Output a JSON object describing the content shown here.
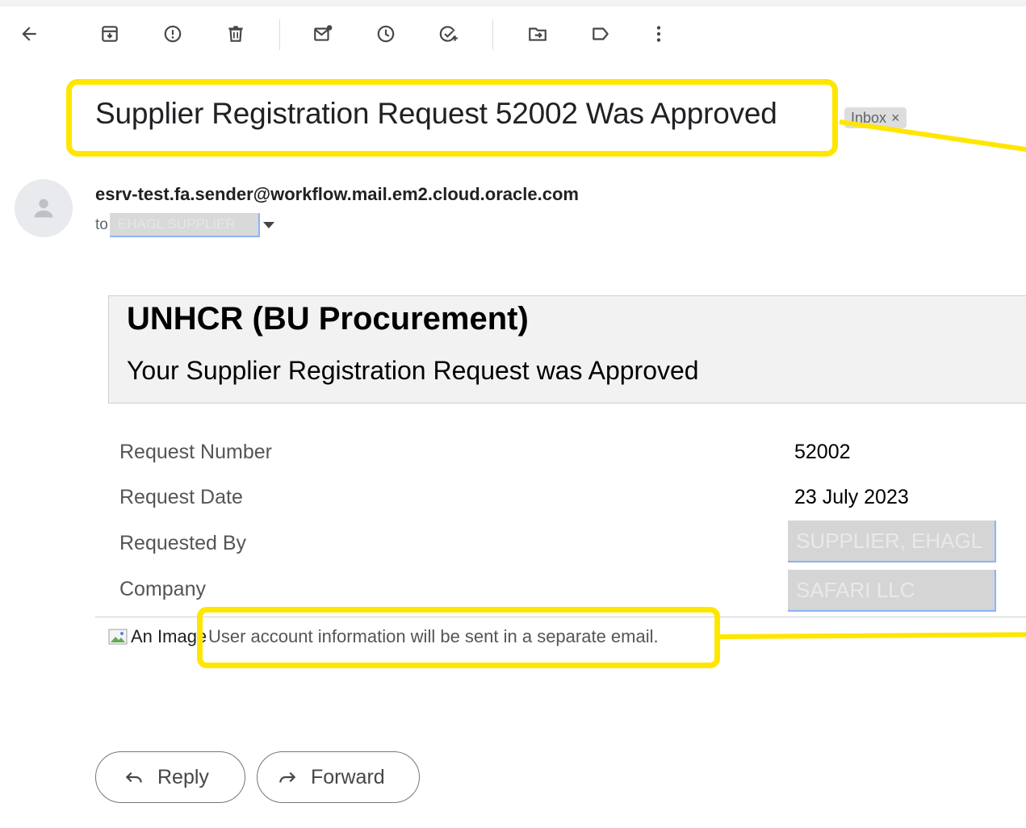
{
  "toolbar": {
    "icons": [
      "back-arrow-icon",
      "archive-icon",
      "report-spam-icon",
      "delete-icon",
      "mark-unread-icon",
      "snooze-icon",
      "add-to-tasks-icon",
      "move-to-icon",
      "label-icon",
      "more-icon"
    ]
  },
  "message": {
    "subject": "Supplier Registration Request 52002 Was Approved",
    "label_chip": "Inbox",
    "label_chip_close": "×",
    "sender_email": "esrv-test.fa.sender@workflow.mail.em2.cloud.oracle.com",
    "to_prefix": "to",
    "to_recipient": "EHAGL SUPPLIER"
  },
  "email_body": {
    "org_name": "UNHCR (BU Procurement)",
    "headline": "Your Supplier Registration Request was Approved",
    "rows": [
      {
        "label": "Request Number",
        "value": "52002"
      },
      {
        "label": "Request Date",
        "value": "23 July 2023"
      },
      {
        "label": "Requested By",
        "value": "SUPPLIER, EHAGL"
      },
      {
        "label": "Company",
        "value": "SAFARI LLC"
      }
    ],
    "image_alt": "An Image",
    "notice": "User account information will be sent in a separate email."
  },
  "actions": {
    "reply_label": "Reply",
    "forward_label": "Forward"
  },
  "colors": {
    "highlight": "#ffe600",
    "redaction": "#d9d9d9"
  }
}
